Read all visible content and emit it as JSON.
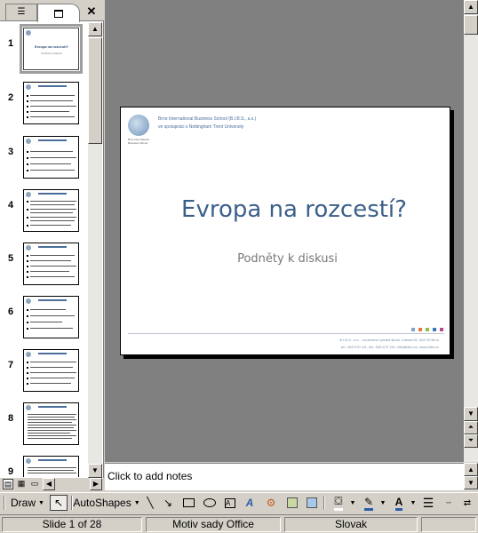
{
  "thumbnails": {
    "numbers": [
      "1",
      "2",
      "3",
      "4",
      "5",
      "6",
      "7",
      "8",
      "9"
    ],
    "slide1_title": "Evropa na rozcestí?",
    "slide1_subtitle": "Podněty k diskusi"
  },
  "slide": {
    "school_name": "Brno International Business School (B.I.B.S., a.s.)",
    "school_partner": "ve spolupráci s Nottingham Trent University",
    "logo_caption": "Brno International Business School",
    "title": "Evropa na rozcestí?",
    "subtitle": "Podněty k diskusi",
    "footer_line1": "B.I.B.S., a.s. - soukromá vysoká škola, Lidická 81, 602 00 Brno",
    "footer_line2": "tel.: 545 570 111, fax: 545 570 115, info@bibs.cz, www.bibs.cz",
    "dot_colors": [
      "#7fa2c8",
      "#e07a3a",
      "#8cbf4a",
      "#3a76b8",
      "#b84a8c"
    ]
  },
  "notes": {
    "placeholder": "Click to add notes"
  },
  "drawbar": {
    "draw_label": "Draw",
    "autoshapes_label": "AutoShapes"
  },
  "statusbar": {
    "slide_info": "Slide 1 of 28",
    "design": "Motiv sady Office",
    "language": "Slovak"
  },
  "colors": {
    "title_blue": "#3b5f8a",
    "workspace": "#808080",
    "chrome": "#d4d0c8"
  }
}
